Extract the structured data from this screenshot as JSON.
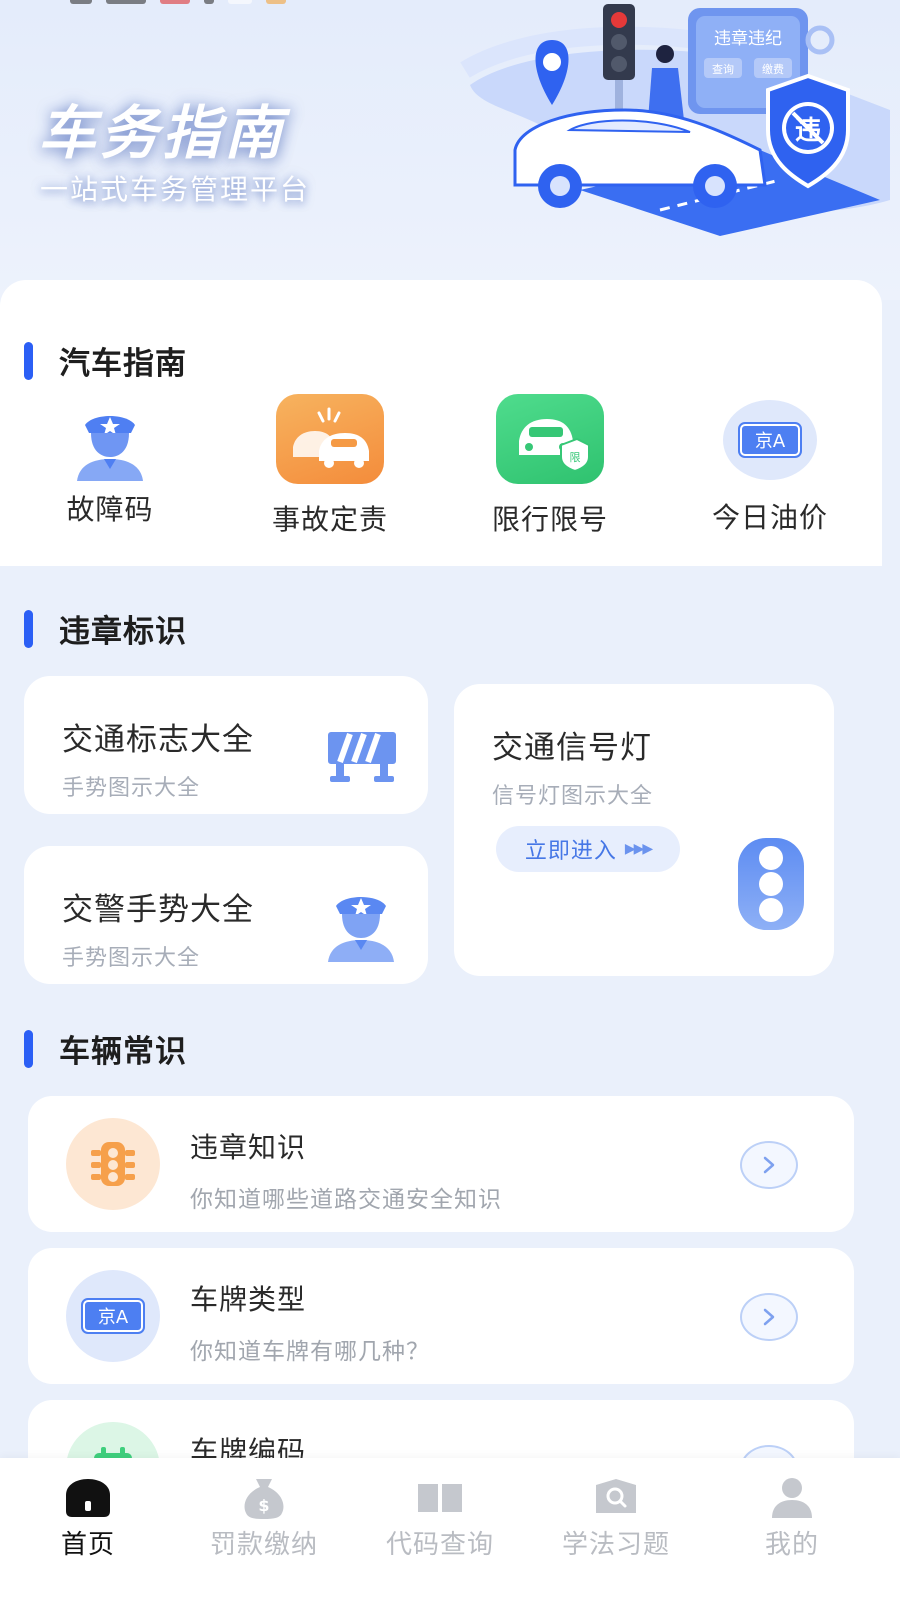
{
  "banner": {
    "title": "车务指南",
    "subtitle": "一站式车务管理平台",
    "art_sign_text": "违章违纪",
    "art_sign_buttons": [
      "查询",
      "缴费"
    ],
    "art_shield_text": "违"
  },
  "colors": {
    "accent": "#2b5ff5",
    "page_bg": "#eaf0fb",
    "card_bg": "#ffffff",
    "orange": "#f6a04b",
    "green": "#3fcf7d",
    "light_blue": "#6b93ee"
  },
  "guide": {
    "title": "汽车指南",
    "items": [
      {
        "label": "故障码",
        "icon": "traffic-police-icon"
      },
      {
        "label": "事故定责",
        "icon": "car-accident-icon"
      },
      {
        "label": "限行限号",
        "icon": "restricted-car-icon"
      },
      {
        "label": "今日油价",
        "icon": "license-plate-icon",
        "plate": "京A"
      }
    ]
  },
  "violation": {
    "title": "违章标识",
    "cards": [
      {
        "title": "交通标志大全",
        "subtitle": "手势图示大全",
        "icon": "road-barrier-icon"
      },
      {
        "title": "交警手势大全",
        "subtitle": "手势图示大全",
        "icon": "traffic-police-icon"
      },
      {
        "title": "交通信号灯",
        "subtitle": "信号灯图示大全",
        "button": "立即进入",
        "icon": "traffic-light-icon"
      }
    ]
  },
  "common": {
    "title": "车辆常识",
    "items": [
      {
        "title": "违章知识",
        "subtitle": "你知道哪些道路交通安全知识",
        "icon": "traffic-light-icon"
      },
      {
        "title": "车牌类型",
        "subtitle": "你知道车牌有哪几种？",
        "icon": "license-plate-icon",
        "plate": "京A"
      },
      {
        "title": "车牌编码",
        "subtitle": "",
        "icon": "calendar-icon"
      }
    ]
  },
  "tabs": [
    {
      "label": "首页",
      "icon": "home-icon",
      "active": true
    },
    {
      "label": "罚款缴纳",
      "icon": "money-bag-icon",
      "active": false
    },
    {
      "label": "代码查询",
      "icon": "book-icon",
      "active": false
    },
    {
      "label": "学法习题",
      "icon": "search-doc-icon",
      "active": false
    },
    {
      "label": "我的",
      "icon": "user-icon",
      "active": false
    }
  ]
}
